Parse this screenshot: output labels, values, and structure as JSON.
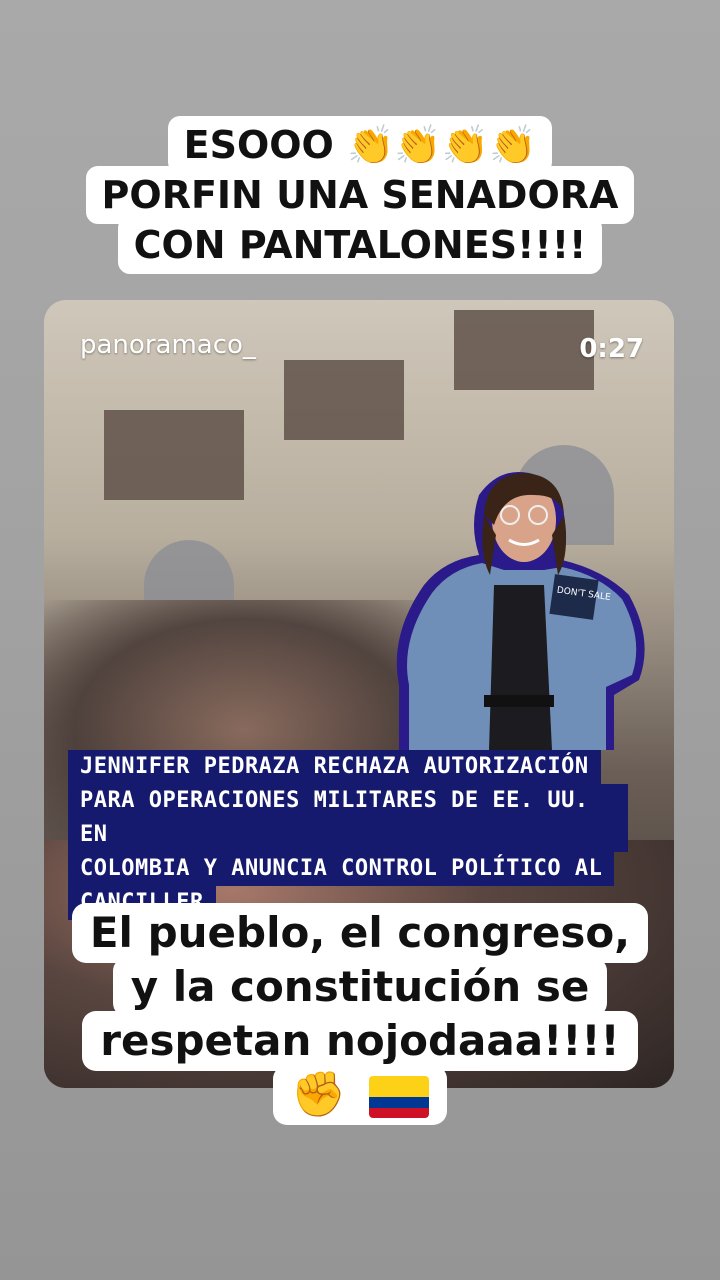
{
  "top_caption": {
    "line1": "ESOOO 👏👏👏👏",
    "line2": "PORFIN UNA SENADORA",
    "line3": "CON PANTALONES!!!!"
  },
  "video": {
    "username": "panoramaco_",
    "timer": "0:27",
    "headline": [
      "JENNIFER PEDRAZA RECHAZA AUTORIZACIÓN",
      "PARA OPERACIONES MILITARES DE EE. UU. EN",
      "COLOMBIA Y ANUNCIA CONTROL POLÍTICO AL",
      "CANCILLER"
    ],
    "jacket_patch": "DON'T SALE"
  },
  "bottom_caption": {
    "line1": "El pueblo, el congreso,",
    "line2": "y la constitución se",
    "line3": "respetan nojodaaa!!!!",
    "line4": "✊"
  },
  "colors": {
    "headline_bg": "#161a6e",
    "caption_bg": "#ffffff",
    "outline": "#2a1a8a",
    "flag": [
      "#FCD116",
      "#003893",
      "#CE1126"
    ]
  }
}
